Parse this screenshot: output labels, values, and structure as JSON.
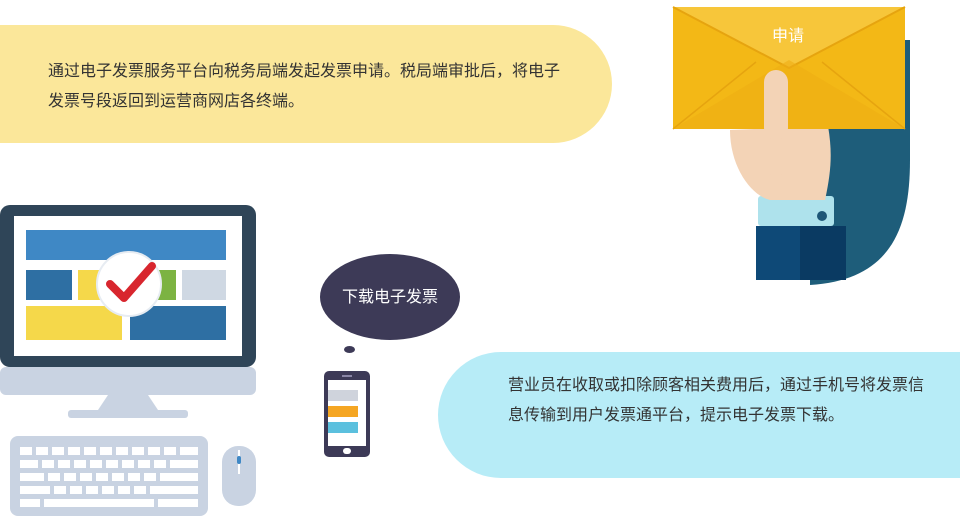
{
  "top_info": {
    "text": "通过电子发票服务平台向税务局端发起发票申请。税局端审批后，将电子发票号段返回到运营商网店各终端。"
  },
  "envelope": {
    "label": "申请"
  },
  "speech_bubble": {
    "text": "下载电子发票"
  },
  "bottom_info": {
    "text": "营业员在收取或扣除顾客相关费用后，通过手机号将发票信息传输到用户发票通平台，提示电子发票下载。"
  },
  "colors": {
    "yellow_bubble": "#fbe79a",
    "cyan_bubble": "#b7ecf7",
    "navy": "#3d3a57",
    "envelope": "#f3b816",
    "monitor_frame": "#2f4558",
    "check_red": "#d8262e"
  },
  "icons": [
    "envelope-icon",
    "hand-icon",
    "monitor-icon",
    "check-icon",
    "keyboard-icon",
    "mouse-icon",
    "phone-icon"
  ]
}
